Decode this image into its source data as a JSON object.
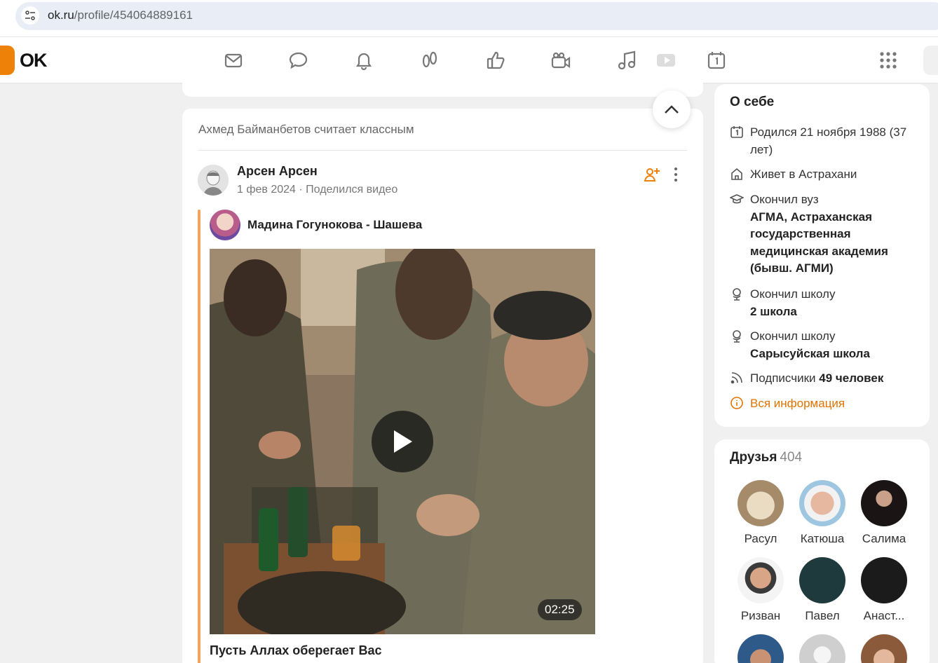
{
  "browser": {
    "url_host": "ok.ru",
    "url_path": "/profile/454064889161"
  },
  "logo": {
    "text": "OK"
  },
  "nav_icons": [
    "mail-icon",
    "chat-icon",
    "bell-icon",
    "guests-icon",
    "like-icon",
    "camera-icon",
    "music-icon",
    "video-icon",
    "calendar-icon",
    "apps-grid-icon"
  ],
  "feed": {
    "liked_by": "Ахмед Байманбетов считает классным",
    "post": {
      "author": "Арсен Арсен",
      "date": "1 фев 2024",
      "action": "Поделился видео",
      "repost_author": "Мадина Гогунокова - Шашева",
      "video_duration": "02:25",
      "video_title": "Пусть Аллах оберегает Вас"
    }
  },
  "about": {
    "title": "О себе",
    "born": "Родился 21 ноября 1988 (37 лет)",
    "lives": "Живет в Астрахани",
    "university_label": "Окончил вуз",
    "university_name": "АГМА, Астраханская государственная медицинская академия (бывш. АГМИ)",
    "school1_label": "Окончил школу",
    "school1_name": "2 школа",
    "school2_label": "Окончил школу",
    "school2_name": "Сарысуйская школа",
    "subscribers_label": "Подписчики",
    "subscribers_value": "49 человек",
    "all_info_link": "Вся информация"
  },
  "friends": {
    "title": "Друзья",
    "count": "404",
    "items": [
      {
        "name": "Расул"
      },
      {
        "name": "Катюша"
      },
      {
        "name": "Салима"
      },
      {
        "name": "Ризван"
      },
      {
        "name": "Павел"
      },
      {
        "name": "Анаст..."
      }
    ]
  },
  "colors": {
    "accent": "#ee8208",
    "link": "#e07400"
  }
}
